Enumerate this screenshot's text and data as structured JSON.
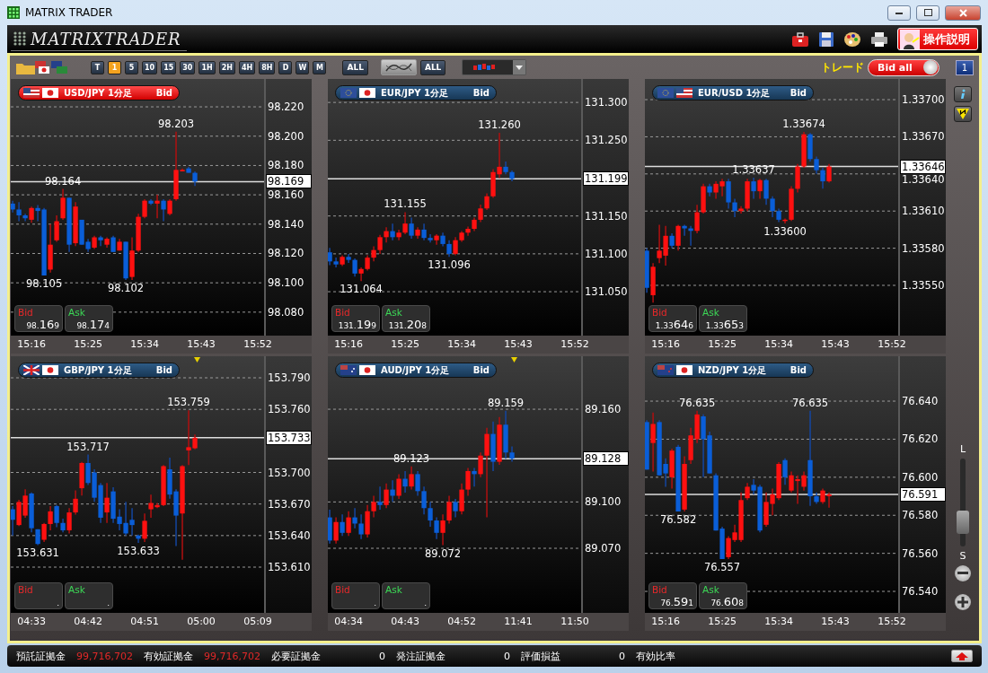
{
  "window": {
    "title": "MATRIX TRADER"
  },
  "logo": "MATRIXTRADER",
  "help_button": "操作説明",
  "toolbar": {
    "periods": [
      {
        "label": "T",
        "selected": false
      },
      {
        "label": "1",
        "selected": true
      },
      {
        "label": "5",
        "selected": false
      },
      {
        "label": "10",
        "selected": false
      },
      {
        "label": "15",
        "selected": false
      },
      {
        "label": "30",
        "selected": false
      },
      {
        "label": "1H",
        "selected": false
      },
      {
        "label": "2H",
        "selected": false
      },
      {
        "label": "4H",
        "selected": false
      },
      {
        "label": "8H",
        "selected": false
      },
      {
        "label": "D",
        "selected": false
      },
      {
        "label": "W",
        "selected": false
      },
      {
        "label": "M",
        "selected": false
      }
    ],
    "period_all": "ALL",
    "indicator_all": "ALL",
    "trade_label": "トレード",
    "bid_toggle": {
      "label": "Bid all",
      "on": true
    },
    "layout_button": "1"
  },
  "side": {
    "top_label": "L",
    "bottom_label": "S",
    "level": 0.2
  },
  "charts": [
    {
      "pair": "USD/JPY 1分足",
      "price_type": "Bid",
      "selected": true,
      "alert_marker": false,
      "bid": {
        "label": "Bid",
        "prefix": "98.",
        "main": "16",
        "pip": "9"
      },
      "ask": {
        "label": "Ask",
        "prefix": "98.",
        "main": "17",
        "pip": "4"
      },
      "chart_data": {
        "type": "candlestick",
        "grid": true,
        "ylim": [
          98.064,
          98.239
        ],
        "ref_lines": [
          {
            "axis": "y",
            "value": 98.169,
            "label": "98.169"
          }
        ],
        "categories": [
          null,
          null,
          null,
          "15:16",
          null,
          null,
          null,
          null,
          null,
          null,
          null,
          null,
          "15:25",
          null,
          null,
          null,
          null,
          null,
          null,
          null,
          null,
          "15:34",
          null,
          null,
          null,
          null,
          null,
          null,
          null,
          null,
          "15:43",
          null,
          null,
          null,
          null,
          null,
          null,
          null,
          null,
          "15:52"
        ],
        "ohlc": [
          [
            98.154,
            98.156,
            98.148,
            98.15
          ],
          [
            98.15,
            98.155,
            98.142,
            98.146
          ],
          [
            98.146,
            98.147,
            98.142,
            98.144
          ],
          [
            98.143,
            98.152,
            98.141,
            98.151
          ],
          [
            98.151,
            98.153,
            98.142,
            98.149
          ],
          [
            98.15,
            98.151,
            98.105,
            98.105
          ],
          [
            98.109,
            98.14,
            98.107,
            98.126
          ],
          [
            98.129,
            98.146,
            98.128,
            98.142
          ],
          [
            98.144,
            98.164,
            98.143,
            98.158
          ],
          [
            98.158,
            98.158,
            98.121,
            98.126
          ],
          [
            98.127,
            98.155,
            98.125,
            98.152
          ],
          [
            98.143,
            98.143,
            98.126,
            98.126
          ],
          [
            98.128,
            98.13,
            98.121,
            98.123
          ],
          [
            98.124,
            98.132,
            98.123,
            98.131
          ],
          [
            98.131,
            98.132,
            98.125,
            98.129
          ],
          [
            98.126,
            98.131,
            98.124,
            98.13
          ],
          [
            98.131,
            98.132,
            98.121,
            98.121
          ],
          [
            98.122,
            98.13,
            98.122,
            98.128
          ],
          [
            98.128,
            98.128,
            98.102,
            98.103
          ],
          [
            98.104,
            98.131,
            98.102,
            98.122
          ],
          [
            98.122,
            98.147,
            98.121,
            98.145
          ],
          [
            98.145,
            98.157,
            98.144,
            98.156
          ],
          [
            98.156,
            98.157,
            98.153,
            98.154
          ],
          [
            98.154,
            98.16,
            98.144,
            98.156
          ],
          [
            98.156,
            98.157,
            98.142,
            98.15
          ],
          [
            98.147,
            98.157,
            98.146,
            98.156
          ],
          [
            98.157,
            98.203,
            98.156,
            98.177
          ],
          [
            98.176,
            98.178,
            98.176,
            98.177
          ],
          [
            98.178,
            98.179,
            98.175,
            98.175
          ],
          [
            98.175,
            98.176,
            98.166,
            98.169
          ],
          null,
          null,
          null,
          null,
          null,
          null,
          null,
          null,
          null,
          null
        ],
        "yticks": [
          {
            "value": 98.22,
            "label": "98.220"
          },
          {
            "value": 98.2,
            "label": "98.200"
          },
          {
            "value": 98.18,
            "label": "98.180"
          },
          {
            "value": 98.16,
            "label": "98.160"
          },
          {
            "value": 98.14,
            "label": "98.140"
          },
          {
            "value": 98.12,
            "label": "98.120"
          },
          {
            "value": 98.1,
            "label": "98.100"
          },
          {
            "value": 98.08,
            "label": "98.080"
          }
        ],
        "annotations": [
          {
            "y": 98.164,
            "text": "98.164"
          },
          {
            "y": 98.105,
            "text": "98.105"
          },
          {
            "y": 98.102,
            "text": "98.102"
          },
          {
            "y": 98.203,
            "text": "98.203"
          }
        ]
      }
    },
    {
      "pair": "EUR/JPY 1分足",
      "price_type": "Bid",
      "selected": false,
      "alert_marker": false,
      "bid": {
        "label": "Bid",
        "prefix": "131.",
        "main": "19",
        "pip": "9"
      },
      "ask": {
        "label": "Ask",
        "prefix": "131.",
        "main": "20",
        "pip": "8"
      },
      "chart_data": {
        "type": "candlestick",
        "grid": true,
        "ylim": [
          130.992,
          131.331
        ],
        "ref_lines": [
          {
            "axis": "y",
            "value": 131.199,
            "label": "131.199"
          }
        ],
        "categories": [
          null,
          null,
          null,
          "15:16",
          null,
          null,
          null,
          null,
          null,
          null,
          null,
          null,
          "15:25",
          null,
          null,
          null,
          null,
          null,
          null,
          null,
          null,
          "15:34",
          null,
          null,
          null,
          null,
          null,
          null,
          null,
          null,
          "15:43",
          null,
          null,
          null,
          null,
          null,
          null,
          null,
          null,
          "15:52"
        ],
        "ohlc": [
          [
            131.102,
            131.108,
            131.085,
            131.09
          ],
          [
            131.09,
            131.095,
            131.082,
            131.086
          ],
          [
            131.086,
            131.098,
            131.084,
            131.096
          ],
          [
            131.096,
            131.1,
            131.088,
            131.092
          ],
          [
            131.092,
            131.094,
            131.07,
            131.074
          ],
          [
            131.074,
            131.082,
            131.064,
            131.08
          ],
          [
            131.08,
            131.098,
            131.078,
            131.095
          ],
          [
            131.095,
            131.11,
            131.09,
            131.105
          ],
          [
            131.105,
            131.125,
            131.1,
            131.122
          ],
          [
            131.122,
            131.135,
            131.115,
            131.13
          ],
          [
            131.13,
            131.14,
            131.118,
            131.122
          ],
          [
            131.122,
            131.132,
            131.118,
            131.128
          ],
          [
            131.128,
            131.155,
            131.126,
            131.14
          ],
          [
            131.14,
            131.148,
            131.12,
            131.124
          ],
          [
            131.124,
            131.135,
            131.12,
            131.132
          ],
          [
            131.132,
            131.14,
            131.118,
            131.121
          ],
          [
            131.121,
            131.126,
            131.115,
            131.118
          ],
          [
            131.118,
            131.126,
            131.112,
            131.124
          ],
          [
            131.124,
            131.128,
            131.11,
            131.113
          ],
          [
            131.113,
            131.118,
            131.096,
            131.1
          ],
          [
            131.1,
            131.122,
            131.098,
            131.118
          ],
          [
            131.118,
            131.13,
            131.116,
            131.128
          ],
          [
            131.128,
            131.136,
            131.124,
            131.133
          ],
          [
            131.133,
            131.148,
            131.13,
            131.145
          ],
          [
            131.145,
            131.165,
            131.142,
            131.16
          ],
          [
            131.16,
            131.18,
            131.158,
            131.176
          ],
          [
            131.176,
            131.212,
            131.174,
            131.208
          ],
          [
            131.205,
            131.26,
            131.2,
            131.215
          ],
          [
            131.215,
            131.222,
            131.205,
            131.208
          ],
          [
            131.208,
            131.21,
            131.196,
            131.199
          ],
          null,
          null,
          null,
          null,
          null,
          null,
          null,
          null,
          null,
          null
        ],
        "yticks": [
          {
            "value": 131.3,
            "label": "131.300"
          },
          {
            "value": 131.25,
            "label": "131.250"
          },
          {
            "value": 131.15,
            "label": "131.150"
          },
          {
            "value": 131.1,
            "label": "131.100"
          },
          {
            "value": 131.05,
            "label": "131.050"
          }
        ],
        "annotations": [
          {
            "y": 131.064,
            "text": "131.064"
          },
          {
            "y": 131.155,
            "text": "131.155"
          },
          {
            "y": 131.096,
            "text": "131.096"
          },
          {
            "y": 131.26,
            "text": "131.260"
          }
        ]
      }
    },
    {
      "pair": "EUR/USD 1分足",
      "price_type": "Bid",
      "selected": false,
      "alert_marker": false,
      "bid": {
        "label": "Bid",
        "prefix": "1.33",
        "main": "64",
        "pip": "6"
      },
      "ask": {
        "label": "Ask",
        "prefix": "1.33",
        "main": "65",
        "pip": "3"
      },
      "chart_data": {
        "type": "candlestick",
        "grid": true,
        "ylim": [
          1.335094,
          1.337167
        ],
        "ref_lines": [
          {
            "axis": "y",
            "value": 1.33646,
            "label": "1.33646"
          }
        ],
        "categories": [
          null,
          null,
          null,
          "15:16",
          null,
          null,
          null,
          null,
          null,
          null,
          null,
          null,
          "15:25",
          null,
          null,
          null,
          null,
          null,
          null,
          null,
          null,
          "15:34",
          null,
          null,
          null,
          null,
          null,
          null,
          null,
          null,
          "15:43",
          null,
          null,
          null,
          null,
          null,
          null,
          null,
          null,
          "15:52"
        ],
        "ohlc": [
          [
            1.33578,
            1.3358,
            1.33544,
            1.33548
          ],
          [
            1.33542,
            1.33568,
            1.33536,
            1.33565
          ],
          [
            1.33572,
            1.33599,
            1.33568,
            1.33578
          ],
          [
            1.33574,
            1.33598,
            1.33566,
            1.3359
          ],
          [
            1.3359,
            1.33592,
            1.3358,
            1.33582
          ],
          [
            1.33582,
            1.33599,
            1.33578,
            1.33598
          ],
          [
            1.33598,
            1.33599,
            1.3359,
            1.33596
          ],
          [
            1.33596,
            1.33598,
            1.33582,
            1.33594
          ],
          [
            1.33594,
            1.33615,
            1.33592,
            1.33609
          ],
          [
            1.33609,
            1.33632,
            1.33608,
            1.3363
          ],
          [
            1.3363,
            1.33632,
            1.33622,
            1.33625
          ],
          [
            1.33625,
            1.33634,
            1.3362,
            1.33632
          ],
          [
            1.3363,
            1.33636,
            1.33622,
            1.33634
          ],
          [
            1.33634,
            1.33636,
            1.33612,
            1.33617
          ],
          [
            1.33617,
            1.3362,
            1.33605,
            1.3361
          ],
          [
            1.3361,
            1.33614,
            1.33608,
            1.33612
          ],
          [
            1.33612,
            1.33636,
            1.3361,
            1.33634
          ],
          [
            1.33634,
            1.33637,
            1.3362,
            1.33626
          ],
          [
            1.33626,
            1.33636,
            1.3362,
            1.33635
          ],
          [
            1.33635,
            1.33636,
            1.33615,
            1.3362
          ],
          [
            1.3362,
            1.33622,
            1.33605,
            1.3361
          ],
          [
            1.3361,
            1.33612,
            1.33601,
            1.33603
          ],
          [
            1.33602,
            1.33604,
            1.336,
            1.33603
          ],
          [
            1.33603,
            1.3363,
            1.33602,
            1.33628
          ],
          [
            1.33628,
            1.33648,
            1.33625,
            1.33646
          ],
          [
            1.33646,
            1.33674,
            1.33645,
            1.33672
          ],
          [
            1.33672,
            1.33673,
            1.3365,
            1.33652
          ],
          [
            1.33652,
            1.33654,
            1.3364,
            1.33643
          ],
          [
            1.33643,
            1.33645,
            1.33628,
            1.33634
          ],
          [
            1.33634,
            1.33648,
            1.33633,
            1.33646
          ],
          null,
          null,
          null,
          null,
          null,
          null,
          null,
          null,
          null,
          null
        ],
        "yticks": [
          {
            "value": 1.337,
            "label": "1.33700"
          },
          {
            "value": 1.3367,
            "label": "1.33670"
          },
          {
            "value": 1.3364,
            "label": "1.33640"
          },
          {
            "value": 1.3361,
            "label": "1.33610"
          },
          {
            "value": 1.3358,
            "label": "1.33580"
          },
          {
            "value": 1.3355,
            "label": "1.33550"
          }
        ],
        "annotations": [
          {
            "y": 1.33637,
            "text": "1.33637"
          },
          {
            "y": 1.336,
            "text": "1.33600"
          },
          {
            "y": 1.33674,
            "text": "1.33674"
          }
        ]
      }
    },
    {
      "pair": "GBP/JPY 1分足",
      "price_type": "Bid",
      "selected": false,
      "alert_marker": true,
      "bid": {
        "label": "Bid",
        "pip": "."
      },
      "ask": {
        "label": "Ask",
        "pip": "."
      },
      "chart_data": {
        "type": "candlestick",
        "grid": true,
        "ylim": [
          153.5665,
          153.8105
        ],
        "ref_lines": [
          {
            "axis": "y",
            "value": 153.733,
            "label": "153.733"
          }
        ],
        "categories": [
          null,
          null,
          null,
          "04:33",
          null,
          null,
          null,
          null,
          null,
          null,
          null,
          null,
          "04:42",
          null,
          null,
          null,
          null,
          null,
          null,
          null,
          null,
          "04:51",
          null,
          null,
          null,
          null,
          null,
          null,
          null,
          null,
          "05:00",
          null,
          null,
          null,
          null,
          null,
          null,
          null,
          null,
          "05:09"
        ],
        "ohlc": [
          [
            153.665,
            153.668,
            153.64,
            153.655
          ],
          [
            153.65,
            153.674,
            153.649,
            153.672
          ],
          [
            153.659,
            153.684,
            153.657,
            153.678
          ],
          [
            153.68,
            153.681,
            153.643,
            153.647
          ],
          [
            153.646,
            153.646,
            153.631,
            153.632
          ],
          [
            153.636,
            153.652,
            153.634,
            153.651
          ],
          [
            153.651,
            153.668,
            153.645,
            153.663
          ],
          [
            153.668,
            153.669,
            153.648,
            153.652
          ],
          [
            153.652,
            153.656,
            153.643,
            153.645
          ],
          [
            153.645,
            153.666,
            153.642,
            153.662
          ],
          [
            153.662,
            153.683,
            153.66,
            153.675
          ],
          [
            153.685,
            153.71,
            153.678,
            153.709
          ],
          [
            153.709,
            153.717,
            153.688,
            153.69
          ],
          [
            153.7,
            153.703,
            153.672,
            153.676
          ],
          [
            153.688,
            153.69,
            153.652,
            153.657
          ],
          [
            153.662,
            153.69,
            153.652,
            153.676
          ],
          [
            153.682,
            153.686,
            153.652,
            153.656
          ],
          [
            153.658,
            153.665,
            153.645,
            153.651
          ],
          [
            153.652,
            153.672,
            153.64,
            153.642
          ],
          [
            153.655,
            153.666,
            153.64,
            153.65
          ],
          [
            153.64,
            153.641,
            153.633,
            153.637
          ],
          [
            153.637,
            153.661,
            153.634,
            153.654
          ],
          [
            153.665,
            153.679,
            153.657,
            153.671
          ],
          [
            153.667,
            153.671,
            153.666,
            153.669
          ],
          [
            153.669,
            153.707,
            153.668,
            153.706
          ],
          [
            153.703,
            153.714,
            153.675,
            153.679
          ],
          [
            153.682,
            153.684,
            153.63,
            153.659
          ],
          [
            153.661,
            153.707,
            153.617,
            153.706
          ],
          [
            153.721,
            153.759,
            153.707,
            153.724
          ],
          [
            153.723,
            153.736,
            153.722,
            153.733
          ],
          null,
          null,
          null,
          null,
          null,
          null,
          null,
          null,
          null,
          null
        ],
        "yticks": [
          {
            "value": 153.79,
            "label": "153.790"
          },
          {
            "value": 153.76,
            "label": "153.760"
          },
          {
            "value": 153.7,
            "label": "153.700"
          },
          {
            "value": 153.67,
            "label": "153.670"
          },
          {
            "value": 153.64,
            "label": "153.640"
          },
          {
            "value": 153.61,
            "label": "153.610"
          }
        ],
        "annotations": [
          {
            "y": 153.631,
            "text": "153.631"
          },
          {
            "y": 153.717,
            "text": "153.717"
          },
          {
            "y": 153.633,
            "text": "153.633"
          },
          {
            "y": 153.759,
            "text": "153.759"
          }
        ]
      }
    },
    {
      "pair": "AUD/JPY 1分足",
      "price_type": "Bid",
      "selected": false,
      "alert_marker": true,
      "bid": {
        "label": "Bid",
        "pip": "."
      },
      "ask": {
        "label": "Ask",
        "pip": "."
      },
      "chart_data": {
        "type": "candlestick",
        "grid": true,
        "ylim": [
          89.0282,
          89.1943
        ],
        "ref_lines": [
          {
            "axis": "y",
            "value": 89.128,
            "label": "89.128"
          }
        ],
        "categories": [
          null,
          null,
          null,
          "04:34",
          null,
          null,
          null,
          null,
          null,
          null,
          null,
          null,
          "04:43",
          null,
          null,
          null,
          null,
          null,
          null,
          null,
          null,
          "04:52",
          null,
          null,
          null,
          null,
          null,
          null,
          null,
          null,
          "11:41",
          null,
          null,
          null,
          null,
          null,
          null,
          null,
          null,
          "11:50"
        ],
        "ohlc": [
          [
            89.09,
            89.095,
            89.073,
            89.075
          ],
          [
            89.075,
            89.09,
            89.073,
            89.087
          ],
          [
            89.087,
            89.092,
            89.078,
            89.08
          ],
          [
            89.08,
            89.094,
            89.078,
            89.09
          ],
          [
            89.09,
            89.096,
            89.083,
            89.086
          ],
          [
            89.086,
            89.092,
            89.076,
            89.079
          ],
          [
            89.079,
            89.098,
            89.077,
            89.094
          ],
          [
            89.094,
            89.104,
            89.09,
            89.1
          ],
          [
            89.1,
            89.11,
            89.095,
            89.098
          ],
          [
            89.098,
            89.112,
            89.096,
            89.108
          ],
          [
            89.108,
            89.114,
            89.1,
            89.104
          ],
          [
            89.104,
            89.118,
            89.102,
            89.115
          ],
          [
            89.115,
            89.12,
            89.106,
            89.11
          ],
          [
            89.11,
            89.123,
            89.108,
            89.118
          ],
          [
            89.118,
            89.12,
            89.104,
            89.107
          ],
          [
            89.107,
            89.11,
            89.092,
            89.096
          ],
          [
            89.096,
            89.1,
            89.084,
            89.088
          ],
          [
            89.088,
            89.09,
            89.076,
            89.08
          ],
          [
            89.08,
            89.092,
            89.072,
            89.088
          ],
          [
            89.088,
            89.104,
            89.086,
            89.1
          ],
          [
            89.1,
            89.102,
            89.09,
            89.094
          ],
          [
            89.094,
            89.112,
            89.092,
            89.108
          ],
          [
            89.108,
            89.122,
            89.104,
            89.12
          ],
          [
            89.12,
            89.122,
            89.11,
            89.118
          ],
          [
            89.118,
            89.132,
            89.116,
            89.13
          ],
          [
            89.13,
            89.148,
            89.09,
            89.144
          ],
          [
            89.144,
            89.152,
            89.12,
            89.126
          ],
          [
            89.126,
            89.155,
            89.124,
            89.15
          ],
          [
            89.15,
            89.159,
            89.128,
            89.132
          ],
          [
            89.132,
            89.136,
            89.126,
            89.128
          ],
          null,
          null,
          null,
          null,
          null,
          null,
          null,
          null,
          null,
          null
        ],
        "yticks": [
          {
            "value": 89.16,
            "label": "89.160"
          },
          {
            "value": 89.1,
            "label": "89.100"
          },
          {
            "value": 89.07,
            "label": "89.070"
          }
        ],
        "annotations": [
          {
            "y": 89.123,
            "text": "89.123"
          },
          {
            "y": 89.072,
            "text": "89.072"
          },
          {
            "y": 89.159,
            "text": "89.159"
          }
        ]
      }
    },
    {
      "pair": "NZD/JPY 1分足",
      "price_type": "Bid",
      "selected": false,
      "alert_marker": false,
      "bid": {
        "label": "Bid",
        "prefix": "76.",
        "main": "59",
        "pip": "1"
      },
      "ask": {
        "label": "Ask",
        "prefix": "76.",
        "main": "60",
        "pip": "8"
      },
      "chart_data": {
        "type": "candlestick",
        "grid": true,
        "ylim": [
          76.5287,
          76.6636
        ],
        "ref_lines": [
          {
            "axis": "y",
            "value": 76.591,
            "label": "76.591"
          }
        ],
        "categories": [
          null,
          null,
          null,
          "15:16",
          null,
          null,
          null,
          null,
          null,
          null,
          null,
          null,
          "15:25",
          null,
          null,
          null,
          null,
          null,
          null,
          null,
          null,
          "15:34",
          null,
          null,
          null,
          null,
          null,
          null,
          null,
          null,
          "15:43",
          null,
          null,
          null,
          null,
          null,
          null,
          null,
          null,
          "15:52"
        ],
        "ohlc": [
          [
            76.629,
            76.63,
            76.604,
            76.604
          ],
          [
            76.618,
            76.634,
            76.603,
            76.628
          ],
          [
            76.629,
            76.63,
            76.601,
            76.601
          ],
          [
            76.607,
            76.61,
            76.595,
            76.602
          ],
          [
            76.6,
            76.615,
            76.594,
            76.614
          ],
          [
            76.616,
            76.617,
            76.582,
            76.582
          ],
          [
            76.583,
            76.611,
            76.582,
            76.607
          ],
          [
            76.609,
            76.626,
            76.607,
            76.622
          ],
          [
            76.62,
            76.635,
            76.618,
            76.633
          ],
          [
            76.632,
            76.633,
            76.6,
            76.62
          ],
          [
            76.622,
            76.624,
            76.602,
            76.602
          ],
          [
            76.601,
            76.602,
            76.572,
            76.572
          ],
          [
            76.573,
            76.574,
            76.557,
            76.557
          ],
          [
            76.558,
            76.569,
            76.557,
            76.568
          ],
          [
            76.567,
            76.575,
            76.566,
            76.571
          ],
          [
            76.567,
            76.592,
            76.566,
            76.588
          ],
          [
            76.589,
            76.597,
            76.588,
            76.595
          ],
          [
            76.596,
            76.599,
            76.591,
            76.593
          ],
          [
            76.595,
            76.596,
            76.571,
            76.572
          ],
          [
            76.575,
            76.592,
            76.574,
            76.587
          ],
          [
            76.586,
            76.594,
            76.58,
            76.591
          ],
          [
            76.589,
            76.608,
            76.588,
            76.607
          ],
          [
            76.609,
            76.61,
            76.596,
            76.6
          ],
          [
            76.593,
            76.603,
            76.592,
            76.601
          ],
          [
            76.598,
            76.601,
            76.586,
            76.599
          ],
          [
            76.595,
            76.603,
            76.593,
            76.601
          ],
          [
            76.609,
            76.635,
            76.585,
            76.59
          ],
          [
            76.59,
            76.592,
            76.586,
            76.587
          ],
          [
            76.587,
            76.594,
            76.586,
            76.593
          ],
          [
            76.59,
            76.592,
            76.584,
            76.591
          ],
          null,
          null,
          null,
          null,
          null,
          null,
          null,
          null,
          null,
          null
        ],
        "yticks": [
          {
            "value": 76.64,
            "label": "76.640"
          },
          {
            "value": 76.62,
            "label": "76.620"
          },
          {
            "value": 76.6,
            "label": "76.600"
          },
          {
            "value": 76.58,
            "label": "76.580"
          },
          {
            "value": 76.56,
            "label": "76.560"
          },
          {
            "value": 76.54,
            "label": "76.540"
          }
        ],
        "annotations": [
          {
            "y": 76.635,
            "text": "76.635"
          },
          {
            "y": 76.582,
            "text": "76.582"
          },
          {
            "y": 76.557,
            "text": "76.557"
          },
          {
            "y": 76.635,
            "text": "76.635"
          }
        ]
      }
    }
  ],
  "status": [
    {
      "label": "預託証拠金",
      "value": "99,716,702",
      "color": "#e02828"
    },
    {
      "label": "有効証拠金",
      "value": "99,716,702",
      "color": "#e02828"
    },
    {
      "label": "必要証拠金",
      "value": "0",
      "color": "#ffffff"
    },
    {
      "label": "発注証拠金",
      "value": "0",
      "color": "#ffffff"
    },
    {
      "label": "評価損益",
      "value": "0",
      "color": "#ffffff"
    },
    {
      "label": "有効比率"
    }
  ]
}
